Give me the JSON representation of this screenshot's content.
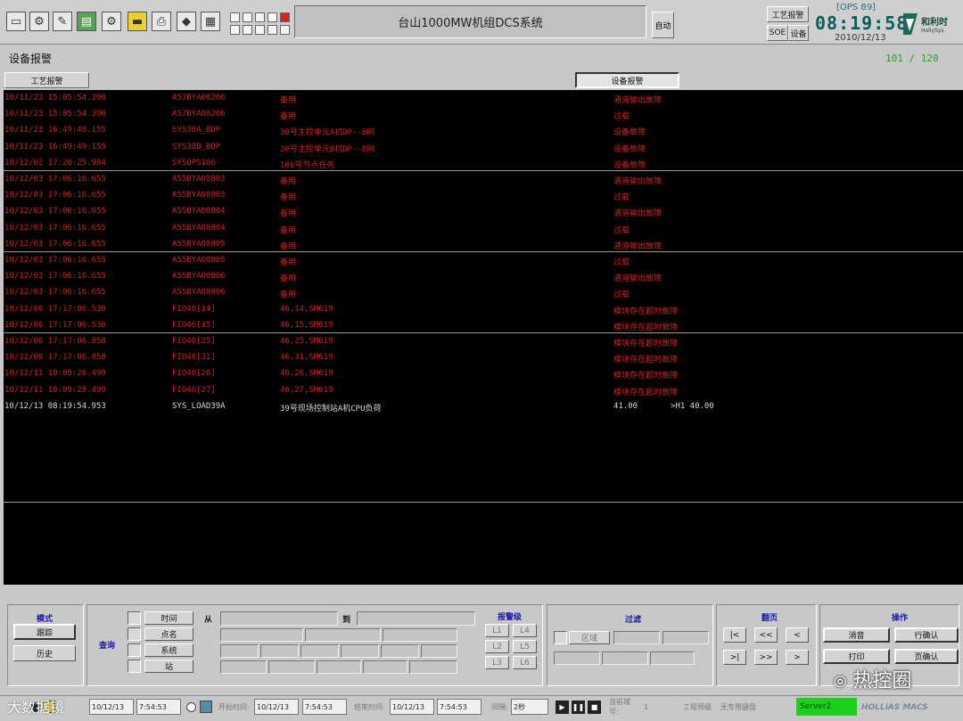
{
  "header": {
    "icons": [
      "monitor-icon",
      "gears-icon",
      "tools-icon",
      "document-icon",
      "settings-icon",
      "folder-icon",
      "printer-icon",
      "tag-icon",
      "clipboard-icon"
    ],
    "title": "台山1000MW机组DCS系统",
    "auto_label": "自动",
    "process_alarm_btn": "工艺报警",
    "soe_btn": "SOE",
    "device_btn": "设备",
    "ops": "[OPS 89]",
    "time": "08:19:58",
    "date": "2010/12/13",
    "logo_text": "和利时",
    "logo_sub": "HollySys"
  },
  "page": {
    "title": "设备报警",
    "count": "101 / 120",
    "tab_process": "工艺报警",
    "tab_device": "设备报警"
  },
  "alarms": [
    {
      "time": "10/11/23 15:05:54.390",
      "tag": "A57BYAO0206",
      "desc": "备用",
      "status": "通道输出故障",
      "extra": "",
      "color": "red"
    },
    {
      "time": "10/11/23 15:05:54.390",
      "tag": "A57BYAO0206",
      "desc": "备用",
      "status": "过载",
      "extra": "",
      "color": "red"
    },
    {
      "time": "10/11/23 16:49:48.155",
      "tag": "SYS30A_BDP",
      "desc": "30号主控单元A机DP--B网",
      "status": "设备故障",
      "extra": "",
      "color": "red"
    },
    {
      "time": "10/11/23 16:49:49.155",
      "tag": "SYS30B_BDP",
      "desc": "30号主控单元B机DP--B网",
      "status": "设备故障",
      "extra": "",
      "color": "red"
    },
    {
      "time": "10/12/02 17:20:25.984",
      "tag": "SYSOPS106",
      "desc": "106号节点任务",
      "status": "设备故障",
      "extra": "",
      "color": "red"
    },
    {
      "time": "10/12/03 17:06:16.655",
      "tag": "A55BYAO0803",
      "desc": "备用",
      "status": "通道输出故障",
      "extra": "",
      "color": "red"
    },
    {
      "time": "10/12/03 17:06:16.655",
      "tag": "A55BYAO0803",
      "desc": "备用",
      "status": "过载",
      "extra": "",
      "color": "red"
    },
    {
      "time": "10/12/03 17:06:16.655",
      "tag": "A55BYAO0804",
      "desc": "备用",
      "status": "通道输出故障",
      "extra": "",
      "color": "red"
    },
    {
      "time": "10/12/03 17:06:16.655",
      "tag": "A55BYAO0804",
      "desc": "备用",
      "status": "过载",
      "extra": "",
      "color": "red"
    },
    {
      "time": "10/12/03 17:06:16.655",
      "tag": "A55BYAO0805",
      "desc": "备用",
      "status": "通道输出故障",
      "extra": "",
      "color": "red"
    },
    {
      "time": "10/12/03 17:06:16.655",
      "tag": "A55BYAO0805",
      "desc": "备用",
      "status": "过载",
      "extra": "",
      "color": "red"
    },
    {
      "time": "10/12/03 17:06:16.655",
      "tag": "A55BYAO0806",
      "desc": "备用",
      "status": "通道输出故障",
      "extra": "",
      "color": "red"
    },
    {
      "time": "10/12/03 17:06:16.655",
      "tag": "A55BYAO0806",
      "desc": "备用",
      "status": "过载",
      "extra": "",
      "color": "red"
    },
    {
      "time": "10/12/06 17:17:06.530",
      "tag": "FIO46[14]",
      "desc": "46,14,SM619",
      "status": "模块存在超时故障",
      "extra": "",
      "color": "red"
    },
    {
      "time": "10/12/06 17:17:06.530",
      "tag": "FIO46[15]",
      "desc": "46,15,SM619",
      "status": "模块存在超时故障",
      "extra": "",
      "color": "red"
    },
    {
      "time": "10/12/06 17:17:06.858",
      "tag": "FIO46[25]",
      "desc": "46,25,SM619",
      "status": "模块存在超时故障",
      "extra": "",
      "color": "red"
    },
    {
      "time": "10/12/06 17:17:06.858",
      "tag": "FIO46[31]",
      "desc": "46,31,SM619",
      "status": "模块存在超时故障",
      "extra": "",
      "color": "red"
    },
    {
      "time": "10/12/11 10:09:28.499",
      "tag": "FIO46[26]",
      "desc": "46,26,SM619",
      "status": "模块存在超时故障",
      "extra": "",
      "color": "red"
    },
    {
      "time": "10/12/11 10:09:28.499",
      "tag": "FIO46[27]",
      "desc": "46,27,SM619",
      "status": "模块存在超时故障",
      "extra": "",
      "color": "red"
    },
    {
      "time": "10/12/13 08:19:54.953",
      "tag": "SYS_LOAD39A",
      "desc": "39号现场控制站A机CPU负荷",
      "status": "41.00",
      "extra": ">H1 40.00",
      "color": "white"
    }
  ],
  "controls": {
    "mode_label": "模式",
    "track_btn": "跟踪",
    "history_btn": "历史",
    "query_label": "查询",
    "time_btn": "时间",
    "point_btn": "点名",
    "system_btn": "系统",
    "station_btn": "站",
    "from_label": "从",
    "to_label": "到",
    "level_label": "报警级",
    "levels": [
      "L1",
      "L4",
      "L2",
      "L5",
      "L3",
      "L6"
    ],
    "filter_label": "过滤",
    "area_btn": "区域",
    "page_label": "翻页",
    "nav": [
      "|<",
      "<<",
      "<",
      ">|",
      ">>",
      ">"
    ],
    "op_label": "操作",
    "silence_btn": "消音",
    "row_ack_btn": "行确认",
    "print_btn": "打印",
    "page_ack_btn": "页确认"
  },
  "statusbar": {
    "date1": "10/12/13",
    "time1": "7:54:53",
    "start_label": "开始时间:",
    "start_date": "10/12/13",
    "start_time": "7:54:53",
    "end_label": "结束时间:",
    "end_date": "10/12/13",
    "end_time": "7:54:53",
    "interval_label": "间隔:",
    "interval_value": "2秒",
    "domain_label": "当前域号:",
    "domain_value": "1",
    "eng_label": "工程师级",
    "keyboard_label": "无专用键盘",
    "server": "Server2",
    "brand": "HOLLiAS MACS"
  },
  "overlay": {
    "wechat": "热控圈",
    "watermark": "大数据镜"
  }
}
